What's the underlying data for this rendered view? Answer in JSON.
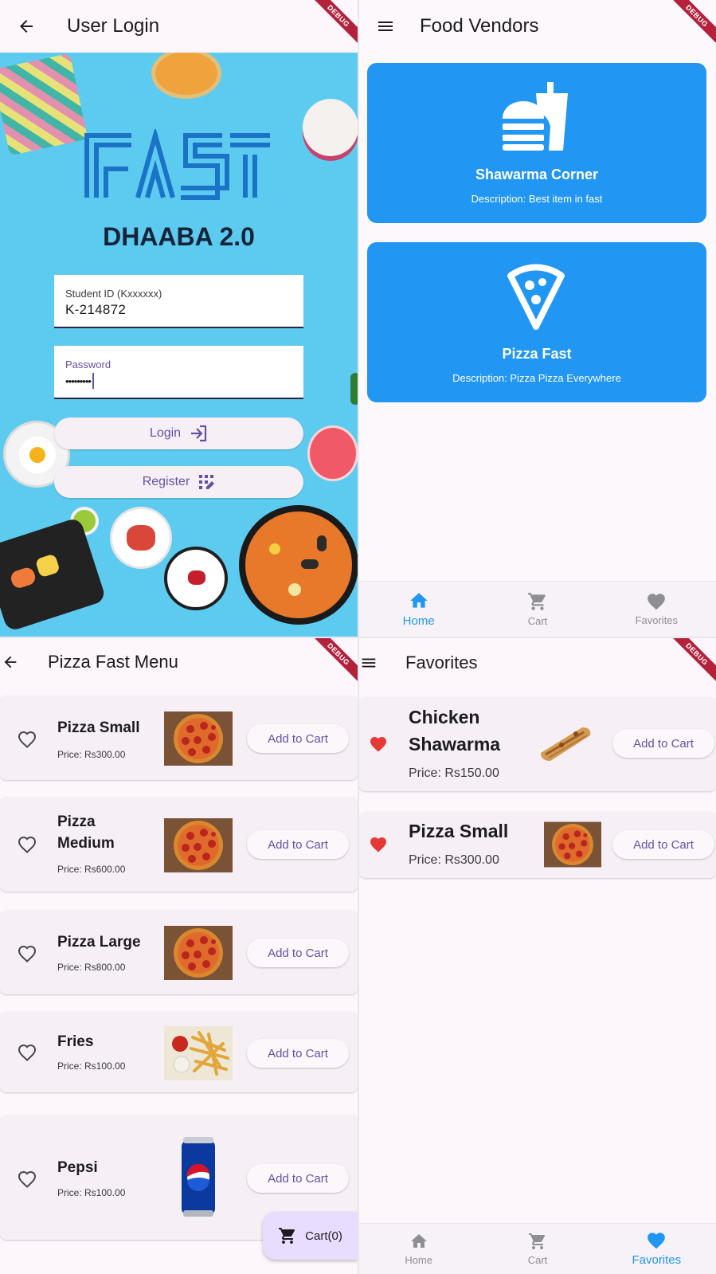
{
  "debug_banner": "DEBUG",
  "login": {
    "title": "User Login",
    "brand": "DHAABA 2.0",
    "student_id_label": "Student ID (Kxxxxxx)",
    "student_id_value": "K-214872",
    "password_label": "Password",
    "password_value": "•••••••••",
    "login_button": "Login",
    "register_button": "Register",
    "colors": {
      "background": "#5dcbf0",
      "logo": "#1a73c7"
    }
  },
  "vendors": {
    "title": "Food Vendors",
    "items": [
      {
        "name": "Shawarma Corner",
        "description": "Description: Best item in fast",
        "icon": "fastfood-icon"
      },
      {
        "name": "Pizza Fast",
        "description": "Description: Pizza Pizza Everywhere",
        "icon": "pizza-slice-icon"
      }
    ],
    "nav": [
      {
        "label": "Home",
        "icon": "home-icon",
        "active": true
      },
      {
        "label": "Cart",
        "icon": "cart-icon",
        "active": false
      },
      {
        "label": "Favorites",
        "icon": "heart-icon",
        "active": false
      }
    ],
    "colors": {
      "card": "#2196f3"
    }
  },
  "menu": {
    "title": "Pizza Fast Menu",
    "items": [
      {
        "name": "Pizza Small",
        "price": "Price: Rs300.00",
        "image": "pizza-image",
        "button": "Add to Cart"
      },
      {
        "name": "Pizza Medium",
        "price": "Price: Rs600.00",
        "image": "pizza-image",
        "button": "Add to Cart"
      },
      {
        "name": "Pizza Large",
        "price": "Price: Rs800.00",
        "image": "pizza-image",
        "button": "Add to Cart"
      },
      {
        "name": "Fries",
        "price": "Price: Rs100.00",
        "image": "fries-image",
        "button": "Add to Cart"
      },
      {
        "name": "Pepsi",
        "price": "Price: Rs100.00",
        "image": "pepsi-can-image",
        "button": "Add to Cart"
      }
    ],
    "cart_button": "Cart(0)"
  },
  "favorites": {
    "title": "Favorites",
    "items": [
      {
        "name": "Chicken Shawarma",
        "price": "Price: Rs150.00",
        "image": "shawarma-image",
        "button": "Add to Cart",
        "favorited": true
      },
      {
        "name": "Pizza Small",
        "price": "Price: Rs300.00",
        "image": "pizza-image",
        "button": "Add to Cart",
        "favorited": true
      }
    ],
    "nav": [
      {
        "label": "Home",
        "icon": "home-icon",
        "active": false
      },
      {
        "label": "Cart",
        "icon": "cart-icon",
        "active": false
      },
      {
        "label": "Favorites",
        "icon": "heart-icon",
        "active": true
      }
    ],
    "colors": {
      "heart": "#e53935",
      "active_nav": "#2196f3"
    }
  }
}
